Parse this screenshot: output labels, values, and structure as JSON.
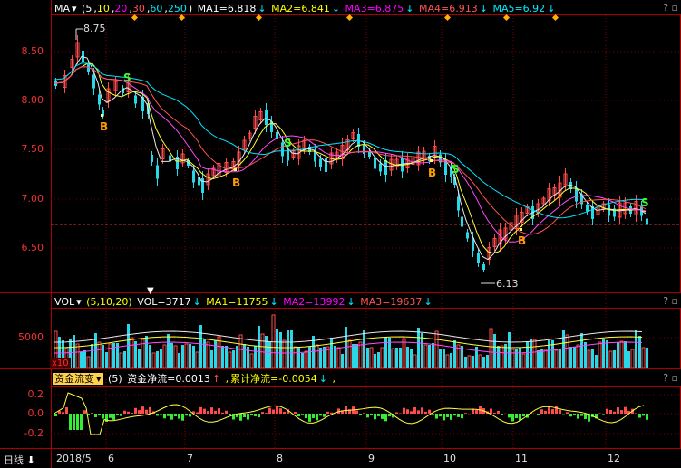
{
  "main": {
    "indicator": "MA",
    "params": "(5,10,20,30,60,250)",
    "params_parts": [
      "5",
      "10",
      "20",
      "30",
      "60",
      "250"
    ],
    "ma1": "MA1=6.818",
    "ma2": "MA2=6.841",
    "ma3": "MA3=6.875",
    "ma4": "MA4=6.913",
    "ma5": "MA5=6.92",
    "y_ticks": [
      "8.50",
      "8.00",
      "7.50",
      "7.00",
      "6.50"
    ],
    "high_label": "8.75",
    "low_label": "6.13",
    "buy_label": "B",
    "sell_label": "S"
  },
  "volume": {
    "indicator": "VOL",
    "params": "(5,10,20)",
    "vol": "VOL=3717",
    "ma1": "MA1=11755",
    "ma2": "MA2=13992",
    "ma3": "MA3=19637",
    "y_tick": "5000",
    "unit": "x10"
  },
  "fund": {
    "indicator": "资金流变",
    "params": "(5)",
    "net": "资金净流=0.0013",
    "cum": "累计净流=-0.0054",
    "trail": ",",
    "y_ticks": [
      "0.2",
      "0.0",
      "-0.2"
    ]
  },
  "footer": {
    "period": "日线",
    "x_ticks": [
      "2018/5",
      "6",
      "7",
      "8",
      "9",
      "10",
      "11",
      "12"
    ]
  },
  "help_button": "?",
  "colors": {
    "up": "#ff4b4b",
    "down": "#28d7e8",
    "ma1": "#e8e8e8",
    "ma2": "#ffff33",
    "ma3": "#ff4bff",
    "ma4": "#ff5555",
    "ma5": "#00e5ff"
  }
}
